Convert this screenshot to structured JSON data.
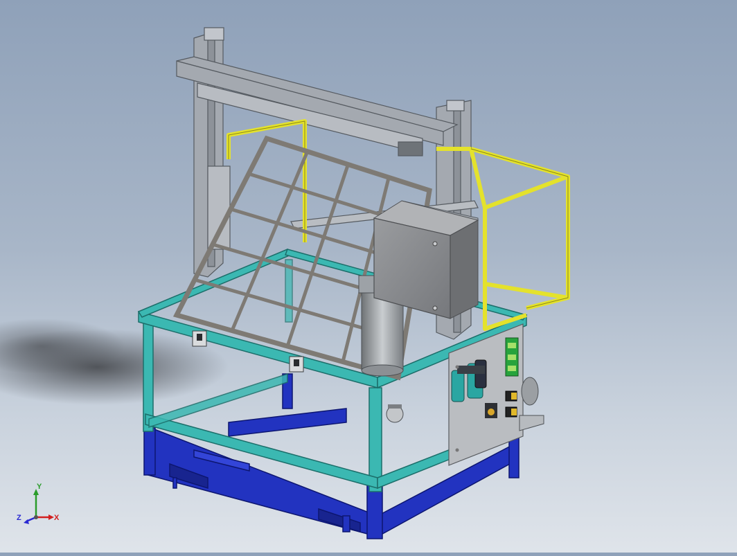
{
  "viewport": {
    "background_top": "#8fa1b9",
    "background_bottom": "#dfe4ea",
    "colors": {
      "frame_gray": "#9ea4ad",
      "frame_teal": "#38b4b0",
      "base_blue": "#1f2fb8",
      "guard_yellow": "#e2e02a",
      "panel_gray": "#8d8f92",
      "plate_gray": "#b9bcc0"
    }
  },
  "triad": {
    "x_label": "X",
    "y_label": "Y",
    "z_label": "Z",
    "x_color": "#d21f1f",
    "y_color": "#2a9c2a",
    "z_color": "#2a2ad2"
  }
}
